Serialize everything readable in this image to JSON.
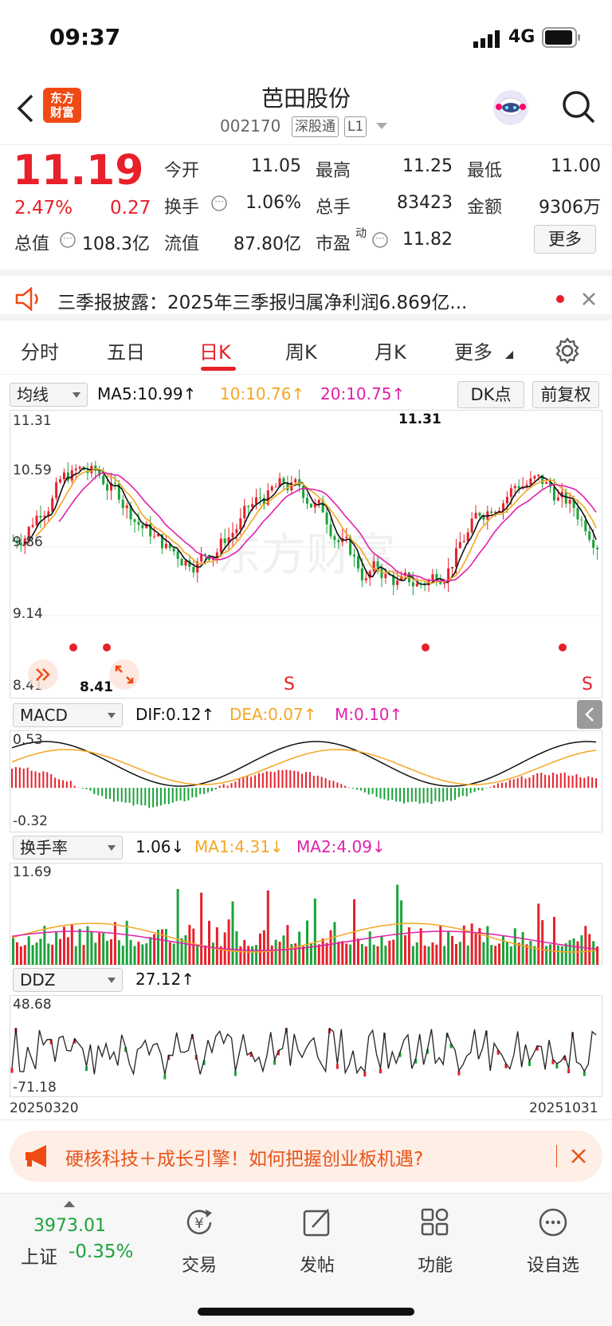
{
  "status_bar": {
    "time": "09:37",
    "network": "4G"
  },
  "header": {
    "logo_text": "东方\n财富",
    "stock_name": "芭田股份",
    "stock_code": "002170",
    "tag1": "深股通",
    "tag2": "L1"
  },
  "quote": {
    "price": "11.19",
    "change_pct": "2.47%",
    "change": "0.27",
    "open_label": "今开",
    "open": "11.05",
    "high_label": "最高",
    "high": "11.25",
    "low_label": "最低",
    "low": "11.00",
    "turnover_label": "换手",
    "turnover": "1.06%",
    "volume_label": "总手",
    "volume": "83423",
    "amount_label": "金额",
    "amount": "9306万",
    "mktcap_label": "总值",
    "mktcap": "108.3亿",
    "float_label": "流值",
    "float": "87.80亿",
    "pe_label": "市盈",
    "pe_sup": "动",
    "pe": "11.82",
    "more": "更多"
  },
  "notice": {
    "text": "三季报披露：2025年三季报归属净利润6.869亿..."
  },
  "tabs": [
    "分时",
    "五日",
    "日K",
    "周K",
    "月K",
    "更多"
  ],
  "active_tab": 2,
  "chart_controls": {
    "ma_select": "均线",
    "dk_button": "DK点",
    "fq_button": "前复权",
    "macd_select": "MACD",
    "turnover_select": "换手率",
    "ddz_select": "DDZ"
  },
  "indicators": {
    "ma5": "MA5:10.99↑",
    "ma10": "10:10.76↑",
    "ma20": "20:10.75↑",
    "dif": "DIF:0.12↑",
    "dea": "DEA:0.07↑",
    "m": "M:0.10↑",
    "turnover_val": "1.06↓",
    "ma1": "MA1:4.31↓",
    "ma2": "MA2:4.09↓",
    "ddz_val": "27.12↑"
  },
  "chart_data": [
    {
      "type": "candlestick",
      "y_ticks": [
        "11.31",
        "10.59",
        "9.86",
        "9.14",
        "8.41"
      ],
      "ylim": [
        8.41,
        11.31
      ],
      "annotations": [
        "11.31",
        "8.41",
        "S",
        "S"
      ],
      "series": [
        {
          "name": "MA5"
        },
        {
          "name": "10"
        },
        {
          "name": "20"
        }
      ]
    },
    {
      "type": "bar",
      "title": "MACD",
      "y_ticks": [
        "0.53",
        "-0.32"
      ],
      "ylim": [
        -0.32,
        0.53
      ]
    },
    {
      "type": "bar",
      "title": "换手率",
      "y_ticks": [
        "11.69"
      ],
      "ylim": [
        0,
        11.69
      ]
    },
    {
      "type": "line",
      "title": "DDZ",
      "y_ticks": [
        "48.68",
        "-71.18"
      ],
      "ylim": [
        -71.18,
        48.68
      ],
      "x_ticks": [
        "20250320",
        "20251031"
      ]
    }
  ],
  "promo": {
    "text": "硬核科技＋成长引擎！如何把握创业板机遇?"
  },
  "bottom_nav": {
    "index_value": "3973.01",
    "index_name": "上证",
    "index_change": "-0.35%",
    "items": [
      "交易",
      "发帖",
      "功能",
      "设自选"
    ]
  },
  "colors": {
    "up": "#e8202a",
    "down": "#1aa33a",
    "ma5": "#111111",
    "ma10": "#f5a623",
    "ma20": "#e020a8",
    "accent": "#f04a14"
  }
}
